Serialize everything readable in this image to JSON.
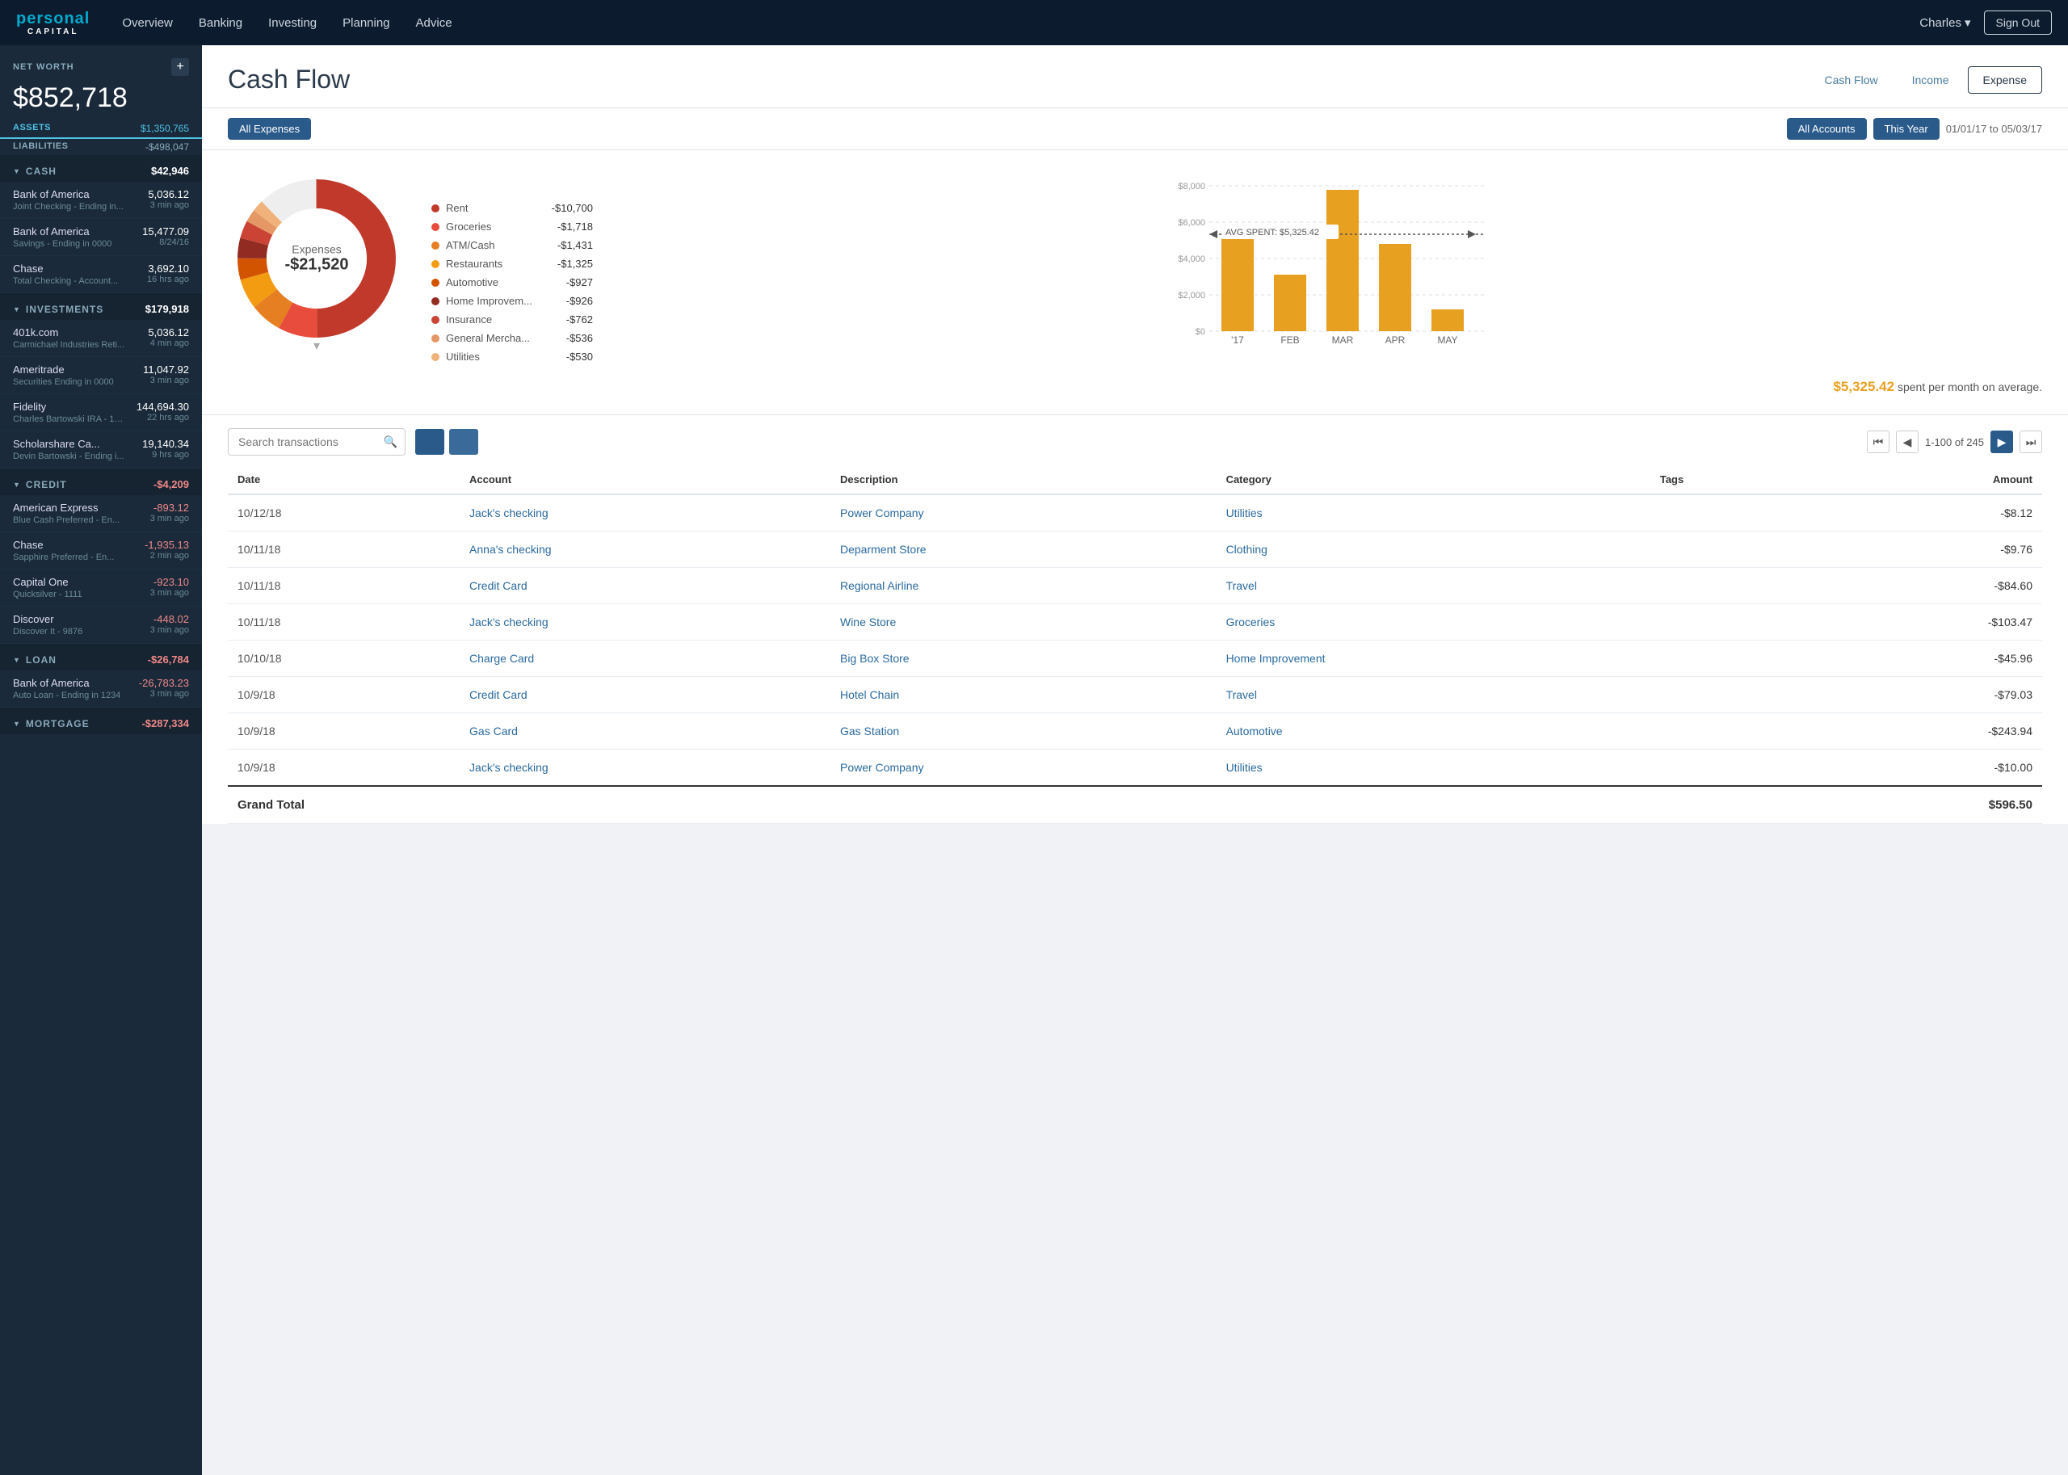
{
  "app": {
    "logo_personal": "personal",
    "logo_capital": "CAPITAL"
  },
  "nav": {
    "links": [
      "Overview",
      "Banking",
      "Investing",
      "Planning",
      "Advice"
    ],
    "user": "Charles",
    "signout": "Sign Out"
  },
  "sidebar": {
    "net_worth_label": "NET WORTH",
    "add_btn": "+",
    "net_worth_value": "$852,718",
    "assets_label": "ASSETS",
    "assets_value": "$1,350,765",
    "liabilities_label": "LIABILITIES",
    "liabilities_value": "-$498,047",
    "sections": [
      {
        "id": "cash",
        "title": "CASH",
        "total": "$42,946",
        "negative": false,
        "accounts": [
          {
            "name": "Bank of America",
            "sub": "Joint Checking - Ending in...",
            "value": "5,036.12",
            "time": "3 min ago",
            "negative": false
          },
          {
            "name": "Bank of America",
            "sub": "Savings - Ending in 0000",
            "value": "15,477.09",
            "time": "8/24/16",
            "negative": false
          },
          {
            "name": "Chase",
            "sub": "Total Checking - Account...",
            "value": "3,692.10",
            "time": "16 hrs ago",
            "negative": false
          }
        ]
      },
      {
        "id": "investments",
        "title": "INVESTMENTS",
        "total": "$179,918",
        "negative": false,
        "accounts": [
          {
            "name": "401k.com",
            "sub": "Carmichael Industries Reti...",
            "value": "5,036.12",
            "time": "4 min ago",
            "negative": false
          },
          {
            "name": "Ameritrade",
            "sub": "Securities Ending in 0000",
            "value": "11,047.92",
            "time": "3 min ago",
            "negative": false
          },
          {
            "name": "Fidelity",
            "sub": "Charles Bartowski IRA - 12...",
            "value": "144,694.30",
            "time": "22 hrs ago",
            "negative": false
          },
          {
            "name": "Scholarshare Ca...",
            "sub": "Devin Bartowski - Ending i...",
            "value": "19,140.34",
            "time": "9 hrs ago",
            "negative": false
          }
        ]
      },
      {
        "id": "credit",
        "title": "CREDIT",
        "total": "-$4,209",
        "negative": true,
        "accounts": [
          {
            "name": "American Express",
            "sub": "Blue Cash Preferred - En...",
            "value": "-893.12",
            "time": "3 min ago",
            "negative": true
          },
          {
            "name": "Chase",
            "sub": "Sapphire Preferred - En...",
            "value": "-1,935.13",
            "time": "2 min ago",
            "negative": true
          },
          {
            "name": "Capital One",
            "sub": "Quicksilver - 1111",
            "value": "-923.10",
            "time": "3 min ago",
            "negative": true
          },
          {
            "name": "Discover",
            "sub": "Discover It - 9876",
            "value": "-448.02",
            "time": "3 min ago",
            "negative": true
          }
        ]
      },
      {
        "id": "loan",
        "title": "LOAN",
        "total": "-$26,784",
        "negative": true,
        "accounts": [
          {
            "name": "Bank of America",
            "sub": "Auto Loan - Ending in 1234",
            "value": "-26,783.23",
            "time": "3 min ago",
            "negative": true
          }
        ]
      },
      {
        "id": "mortgage",
        "title": "MORTGAGE",
        "total": "-$287,334",
        "negative": true,
        "accounts": []
      }
    ]
  },
  "page": {
    "title": "Cash Flow",
    "view_tabs": [
      "Cash Flow",
      "Income",
      "Expense"
    ],
    "active_tab": "Expense"
  },
  "filters": {
    "expense_btn": "All Expenses",
    "accounts_btn": "All Accounts",
    "year_btn": "This Year",
    "date_range": "01/01/17 to 05/03/17"
  },
  "chart": {
    "donut_label": "Expenses",
    "donut_value": "-$21,520",
    "legend": [
      {
        "color": "#c0392b",
        "name": "Rent",
        "amount": "-$10,700"
      },
      {
        "color": "#e74c3c",
        "name": "Groceries",
        "amount": "-$1,718"
      },
      {
        "color": "#e67e22",
        "name": "ATM/Cash",
        "amount": "-$1,431"
      },
      {
        "color": "#f39c12",
        "name": "Restaurants",
        "amount": "-$1,325"
      },
      {
        "color": "#d35400",
        "name": "Automotive",
        "amount": "-$927"
      },
      {
        "color": "#922b21",
        "name": "Home Improvem...",
        "amount": "-$926"
      },
      {
        "color": "#cb4335",
        "name": "Insurance",
        "amount": "-$762"
      },
      {
        "color": "#e59866",
        "name": "General Mercha...",
        "amount": "-$536"
      },
      {
        "color": "#f0b27a",
        "name": "Utilities",
        "amount": "-$530"
      }
    ],
    "bars": [
      {
        "label": "'17",
        "value": 5200,
        "color": "#e8a020"
      },
      {
        "label": "FEB",
        "value": 3100,
        "color": "#e8a020"
      },
      {
        "label": "MAR",
        "value": 7800,
        "color": "#e8a020"
      },
      {
        "label": "APR",
        "value": 4800,
        "color": "#e8a020"
      },
      {
        "label": "MAY",
        "value": 1200,
        "color": "#e8a020"
      }
    ],
    "max_value": 8000,
    "avg_label": "AVG SPENT: $5,325.42",
    "avg_value": 5325.42,
    "monthly_avg_text": "spent per month on average.",
    "monthly_avg_amount": "$5,325.42",
    "y_labels": [
      "$8,000",
      "$6,000",
      "$4,000",
      "$2,000",
      "$0"
    ]
  },
  "transactions": {
    "search_placeholder": "Search transactions",
    "pagination_text": "1-100 of 245",
    "columns": [
      "Date",
      "Account",
      "Description",
      "Category",
      "Tags",
      "Amount"
    ],
    "rows": [
      {
        "date": "10/12/18",
        "account": "Jack's checking",
        "description": "Power Company",
        "category": "Utilities",
        "tags": "",
        "amount": "-$8.12"
      },
      {
        "date": "10/11/18",
        "account": "Anna's checking",
        "description": "Deparment Store",
        "category": "Clothing",
        "tags": "",
        "amount": "-$9.76"
      },
      {
        "date": "10/11/18",
        "account": "Credit Card",
        "description": "Regional Airline",
        "category": "Travel",
        "tags": "",
        "amount": "-$84.60"
      },
      {
        "date": "10/11/18",
        "account": "Jack's checking",
        "description": "Wine Store",
        "category": "Groceries",
        "tags": "",
        "amount": "-$103.47"
      },
      {
        "date": "10/10/18",
        "account": "Charge Card",
        "description": "Big Box Store",
        "category": "Home Improvement",
        "tags": "",
        "amount": "-$45.96"
      },
      {
        "date": "10/9/18",
        "account": "Credit Card",
        "description": "Hotel Chain",
        "category": "Travel",
        "tags": "",
        "amount": "-$79.03"
      },
      {
        "date": "10/9/18",
        "account": "Gas Card",
        "description": "Gas Station",
        "category": "Automotive",
        "tags": "",
        "amount": "-$243.94"
      },
      {
        "date": "10/9/18",
        "account": "Jack's checking",
        "description": "Power Company",
        "category": "Utilities",
        "tags": "",
        "amount": "-$10.00"
      }
    ],
    "grand_total_label": "Grand Total",
    "grand_total_amount": "$596.50"
  }
}
